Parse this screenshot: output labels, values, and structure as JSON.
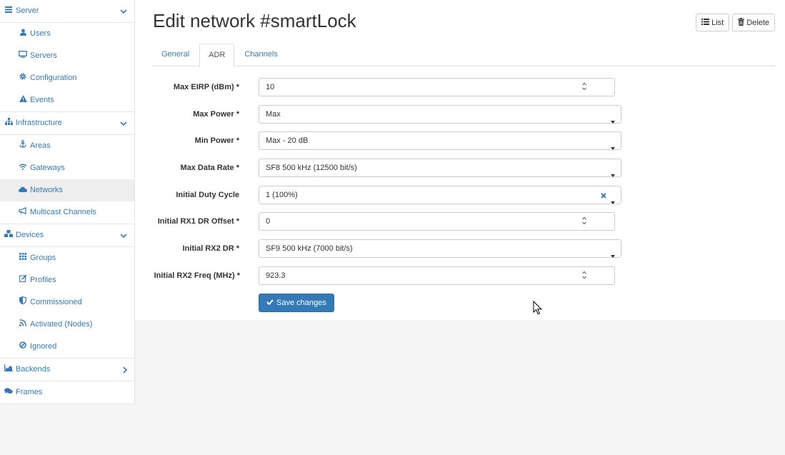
{
  "sidebar": {
    "server": {
      "label": "Server"
    },
    "users": {
      "label": "Users"
    },
    "servers": {
      "label": "Servers"
    },
    "configuration": {
      "label": "Configuration"
    },
    "events": {
      "label": "Events"
    },
    "infrastructure": {
      "label": "Infrastructure"
    },
    "areas": {
      "label": "Areas"
    },
    "gateways": {
      "label": "Gateways"
    },
    "networks": {
      "label": "Networks"
    },
    "multicast": {
      "label": "Multicast Channels"
    },
    "devices": {
      "label": "Devices"
    },
    "groups": {
      "label": "Groups"
    },
    "profiles": {
      "label": "Profiles"
    },
    "commissioned": {
      "label": "Commissioned"
    },
    "activated": {
      "label": "Activated (Nodes)"
    },
    "ignored": {
      "label": "Ignored"
    },
    "backends": {
      "label": "Backends"
    },
    "frames": {
      "label": "Frames"
    }
  },
  "header": {
    "title": "Edit network #smartLock",
    "list_label": "List",
    "delete_label": "Delete"
  },
  "tabs": {
    "general": "General",
    "adr": "ADR",
    "channels": "Channels"
  },
  "form": {
    "max_eirp": {
      "label": "Max EIRP (dBm) *",
      "value": "10"
    },
    "max_power": {
      "label": "Max Power *",
      "value": "Max"
    },
    "min_power": {
      "label": "Min Power *",
      "value": "Max - 20 dB"
    },
    "max_data_rate": {
      "label": "Max Data Rate *",
      "value": "SF8 500 kHz (12500 bit/s)"
    },
    "initial_duty_cycle": {
      "label": "Initial Duty Cycle",
      "value": "1 (100%)"
    },
    "rx1_dr_offset": {
      "label": "Initial RX1 DR Offset *",
      "value": "0"
    },
    "rx2_dr": {
      "label": "Initial RX2 DR *",
      "value": "SF9 500 kHz (7000 bit/s)"
    },
    "rx2_freq": {
      "label": "Initial RX2 Freq (MHz) *",
      "value": "923.3"
    },
    "save_label": "Save changes"
  },
  "colors": {
    "accent": "#337ab7",
    "active_bg": "#eeeeee"
  }
}
